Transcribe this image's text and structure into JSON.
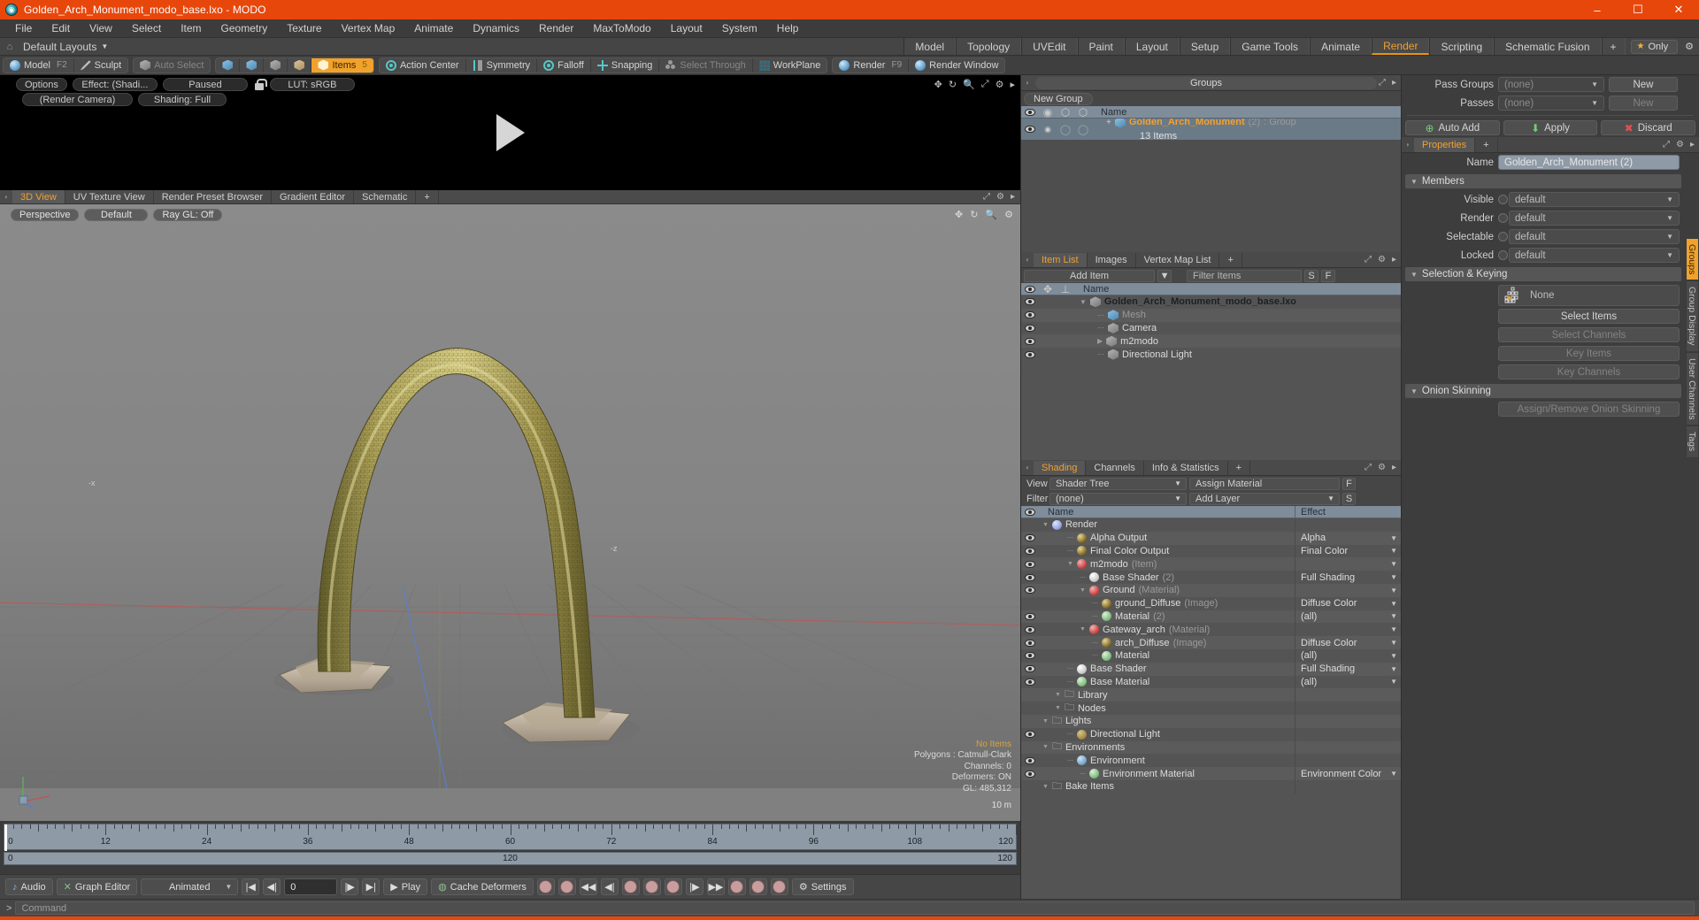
{
  "window": {
    "title": "Golden_Arch_Monument_modo_base.lxo - MODO",
    "app_icon": "modo-logo-icon",
    "minimize": "–",
    "maximize": "☐",
    "close": "✕",
    "accent_color": "#e8470c"
  },
  "menu": {
    "items": [
      "File",
      "Edit",
      "View",
      "Select",
      "Item",
      "Geometry",
      "Texture",
      "Vertex Map",
      "Animate",
      "Dynamics",
      "Render",
      "MaxToModo",
      "Layout",
      "System",
      "Help"
    ]
  },
  "layout_bar": {
    "default_layouts": "Default Layouts",
    "tabs": [
      {
        "label": "Model",
        "active": false
      },
      {
        "label": "Topology",
        "active": false
      },
      {
        "label": "UVEdit",
        "active": false
      },
      {
        "label": "Paint",
        "active": false
      },
      {
        "label": "Layout",
        "active": false
      },
      {
        "label": "Setup",
        "active": false
      },
      {
        "label": "Game Tools",
        "active": false
      },
      {
        "label": "Animate",
        "active": false
      },
      {
        "label": "Render",
        "active": true
      },
      {
        "label": "Scripting",
        "active": false
      },
      {
        "label": "Schematic Fusion",
        "active": false
      },
      {
        "label": "+",
        "active": false
      }
    ],
    "only_label": "Only"
  },
  "mode_toolbar": {
    "model": "Model",
    "model_hotkey": "F2",
    "sculpt": "Sculpt",
    "auto_select": "Auto Select",
    "items": "Items",
    "items_hotkey": "5",
    "action_center": "Action Center",
    "symmetry": "Symmetry",
    "falloff": "Falloff",
    "snapping": "Snapping",
    "select_through": "Select Through",
    "workplane": "WorkPlane",
    "render": "Render",
    "render_hotkey": "F9",
    "render_window": "Render Window"
  },
  "preview": {
    "options": "Options",
    "effect": "Effect: (Shadi...",
    "paused": "Paused",
    "lut": "LUT: sRGB",
    "camera": "(Render Camera)",
    "shading": "Shading: Full"
  },
  "viewport": {
    "tabs": [
      {
        "label": "3D View",
        "active": true
      },
      {
        "label": "UV Texture View",
        "active": false
      },
      {
        "label": "Render Preset Browser",
        "active": false
      },
      {
        "label": "Gradient Editor",
        "active": false
      },
      {
        "label": "Schematic",
        "active": false
      },
      {
        "label": "+",
        "active": false
      }
    ],
    "perspective": "Perspective",
    "default": "Default",
    "raygl": "Ray GL: Off",
    "stats": {
      "no_items": "No Items",
      "polygons": "Polygons : Catmull-Clark",
      "channels": "Channels: 0",
      "deformers": "Deformers: ON",
      "gl": "GL: 485,312"
    },
    "scale": "10 m"
  },
  "timeline": {
    "ticks": [
      0,
      12,
      24,
      36,
      48,
      60,
      72,
      84,
      96,
      108,
      120
    ],
    "range_start": "0",
    "range_mid": "120",
    "range_end": "120",
    "playhead_frame": 0
  },
  "transport": {
    "audio": "Audio",
    "graph_editor": "Graph Editor",
    "animated": "Animated",
    "frame_value": "0",
    "play": "Play",
    "cache_deformers": "Cache Deformers",
    "settings": "Settings"
  },
  "groups_panel": {
    "title": "Groups",
    "new_group": "New Group",
    "column_name": "Name",
    "rows": [
      {
        "name": "Golden_Arch_Monument",
        "count": "(2)",
        "type": ": Group",
        "sub": "13 Items",
        "selected": true
      }
    ]
  },
  "item_list_panel": {
    "tabs": [
      {
        "label": "Item List",
        "active": true
      },
      {
        "label": "Images",
        "active": false
      },
      {
        "label": "Vertex Map List",
        "active": false
      },
      {
        "label": "+",
        "active": false
      }
    ],
    "add_item": "Add Item",
    "filter_items": "Filter Items",
    "btn_s": "S",
    "btn_f": "F",
    "column_name": "Name",
    "rows": [
      {
        "label": "Golden_Arch_Monument_modo_base.lxo",
        "indent": 0,
        "style": "root",
        "icon": "scene-icon"
      },
      {
        "label": "Mesh",
        "indent": 1,
        "style": "dim",
        "icon": "mesh-icon"
      },
      {
        "label": "Camera",
        "indent": 1,
        "style": "normal",
        "icon": "camera-icon"
      },
      {
        "label": "m2modo",
        "indent": 1,
        "style": "normal",
        "icon": "folder-icon"
      },
      {
        "label": "Directional Light",
        "indent": 1,
        "style": "normal",
        "icon": "light-icon"
      }
    ]
  },
  "shading_panel": {
    "tabs": [
      {
        "label": "Shading",
        "active": true
      },
      {
        "label": "Channels",
        "active": false
      },
      {
        "label": "Info & Statistics",
        "active": false
      },
      {
        "label": "+",
        "active": false
      }
    ],
    "view_label": "View",
    "view_value": "Shader Tree",
    "assign_material": "Assign Material",
    "filter_label": "Filter",
    "filter_value": "(none)",
    "add_layer": "Add Layer",
    "btn_f": "F",
    "btn_s": "S",
    "col_name": "Name",
    "col_effect": "Effect",
    "rows": [
      {
        "name": "Render",
        "suffix": "",
        "effect": "",
        "indent": 0,
        "icon": "render-sphere-icon",
        "eye": false,
        "caret": false
      },
      {
        "name": "Alpha Output",
        "suffix": "",
        "effect": "Alpha",
        "indent": 2,
        "icon": "image-output-icon",
        "eye": true,
        "caret": true
      },
      {
        "name": "Final Color Output",
        "suffix": "",
        "effect": "Final Color",
        "indent": 2,
        "icon": "image-output-icon",
        "eye": true,
        "caret": true
      },
      {
        "name": "m2modo",
        "suffix": "(Item)",
        "effect": "",
        "indent": 2,
        "icon": "material-icon",
        "eye": true,
        "caret": true
      },
      {
        "name": "Base Shader",
        "suffix": "(2)",
        "effect": "Full Shading",
        "indent": 3,
        "icon": "shader-icon",
        "eye": true,
        "caret": true
      },
      {
        "name": "Ground",
        "suffix": "(Material)",
        "effect": "",
        "indent": 3,
        "icon": "material-icon",
        "eye": true,
        "caret": true
      },
      {
        "name": "ground_Diffuse",
        "suffix": "(Image)",
        "effect": "Diffuse Color",
        "indent": 4,
        "icon": "image-texture-icon",
        "eye": false,
        "caret": true
      },
      {
        "name": "Material",
        "suffix": "(2)",
        "effect": "(all)",
        "indent": 4,
        "icon": "green-material-icon",
        "eye": true,
        "caret": true
      },
      {
        "name": "Gateway_arch",
        "suffix": "(Material)",
        "effect": "",
        "indent": 3,
        "icon": "material-icon",
        "eye": true,
        "caret": true
      },
      {
        "name": "arch_Diffuse",
        "suffix": "(Image)",
        "effect": "Diffuse Color",
        "indent": 4,
        "icon": "image-texture-icon",
        "eye": true,
        "caret": true
      },
      {
        "name": "Material",
        "suffix": "",
        "effect": "(all)",
        "indent": 4,
        "icon": "green-material-icon",
        "eye": true,
        "caret": true
      },
      {
        "name": "Base Shader",
        "suffix": "",
        "effect": "Full Shading",
        "indent": 2,
        "icon": "shader-icon",
        "eye": true,
        "caret": true
      },
      {
        "name": "Base Material",
        "suffix": "",
        "effect": "(all)",
        "indent": 2,
        "icon": "green-material-icon",
        "eye": true,
        "caret": true
      },
      {
        "name": "Library",
        "suffix": "",
        "effect": "",
        "indent": 1,
        "icon": "folder-icon",
        "eye": false,
        "caret": false
      },
      {
        "name": "Nodes",
        "suffix": "",
        "effect": "",
        "indent": 1,
        "icon": "folder-icon",
        "eye": false,
        "caret": false
      },
      {
        "name": "Lights",
        "suffix": "",
        "effect": "",
        "indent": 0,
        "icon": "group-icon",
        "eye": false,
        "caret": false
      },
      {
        "name": "Directional Light",
        "suffix": "",
        "effect": "",
        "indent": 2,
        "icon": "light-icon",
        "eye": true,
        "caret": false
      },
      {
        "name": "Environments",
        "suffix": "",
        "effect": "",
        "indent": 0,
        "icon": "group-icon",
        "eye": false,
        "caret": false
      },
      {
        "name": "Environment",
        "suffix": "",
        "effect": "",
        "indent": 2,
        "icon": "env-icon",
        "eye": true,
        "caret": false
      },
      {
        "name": "Environment Material",
        "suffix": "",
        "effect": "Environment Color",
        "indent": 3,
        "icon": "green-material-icon",
        "eye": true,
        "caret": true
      },
      {
        "name": "Bake Items",
        "suffix": "",
        "effect": "",
        "indent": 0,
        "icon": "group-icon",
        "eye": false,
        "caret": false
      }
    ]
  },
  "properties_panel": {
    "pass_groups_label": "Pass Groups",
    "pass_groups_value": "(none)",
    "pass_groups_new": "New",
    "passes_label": "Passes",
    "passes_value": "(none)",
    "passes_new": "New",
    "auto_add": "Auto Add",
    "apply": "Apply",
    "discard": "Discard",
    "tab_properties": "Properties",
    "tab_plus": "+",
    "name_label": "Name",
    "name_value": "Golden_Arch_Monument (2)",
    "members_section": "Members",
    "visible_label": "Visible",
    "visible_value": "default",
    "render_label": "Render",
    "render_value": "default",
    "selectable_label": "Selectable",
    "selectable_value": "default",
    "locked_label": "Locked",
    "locked_value": "default",
    "selection_keying_section": "Selection & Keying",
    "none_value": "None",
    "select_items": "Select Items",
    "select_channels": "Select Channels",
    "key_items": "Key Items",
    "key_channels": "Key Channels",
    "onion_skinning_section": "Onion Skinning",
    "assign_remove_onion": "Assign/Remove Onion Skinning",
    "side_tabs": [
      {
        "label": "Groups",
        "active": true
      },
      {
        "label": "Group Display",
        "active": false
      },
      {
        "label": "User Channels",
        "active": false
      },
      {
        "label": "Tags",
        "active": false
      }
    ]
  },
  "command_bar": {
    "prompt": ">",
    "placeholder": "Command"
  }
}
